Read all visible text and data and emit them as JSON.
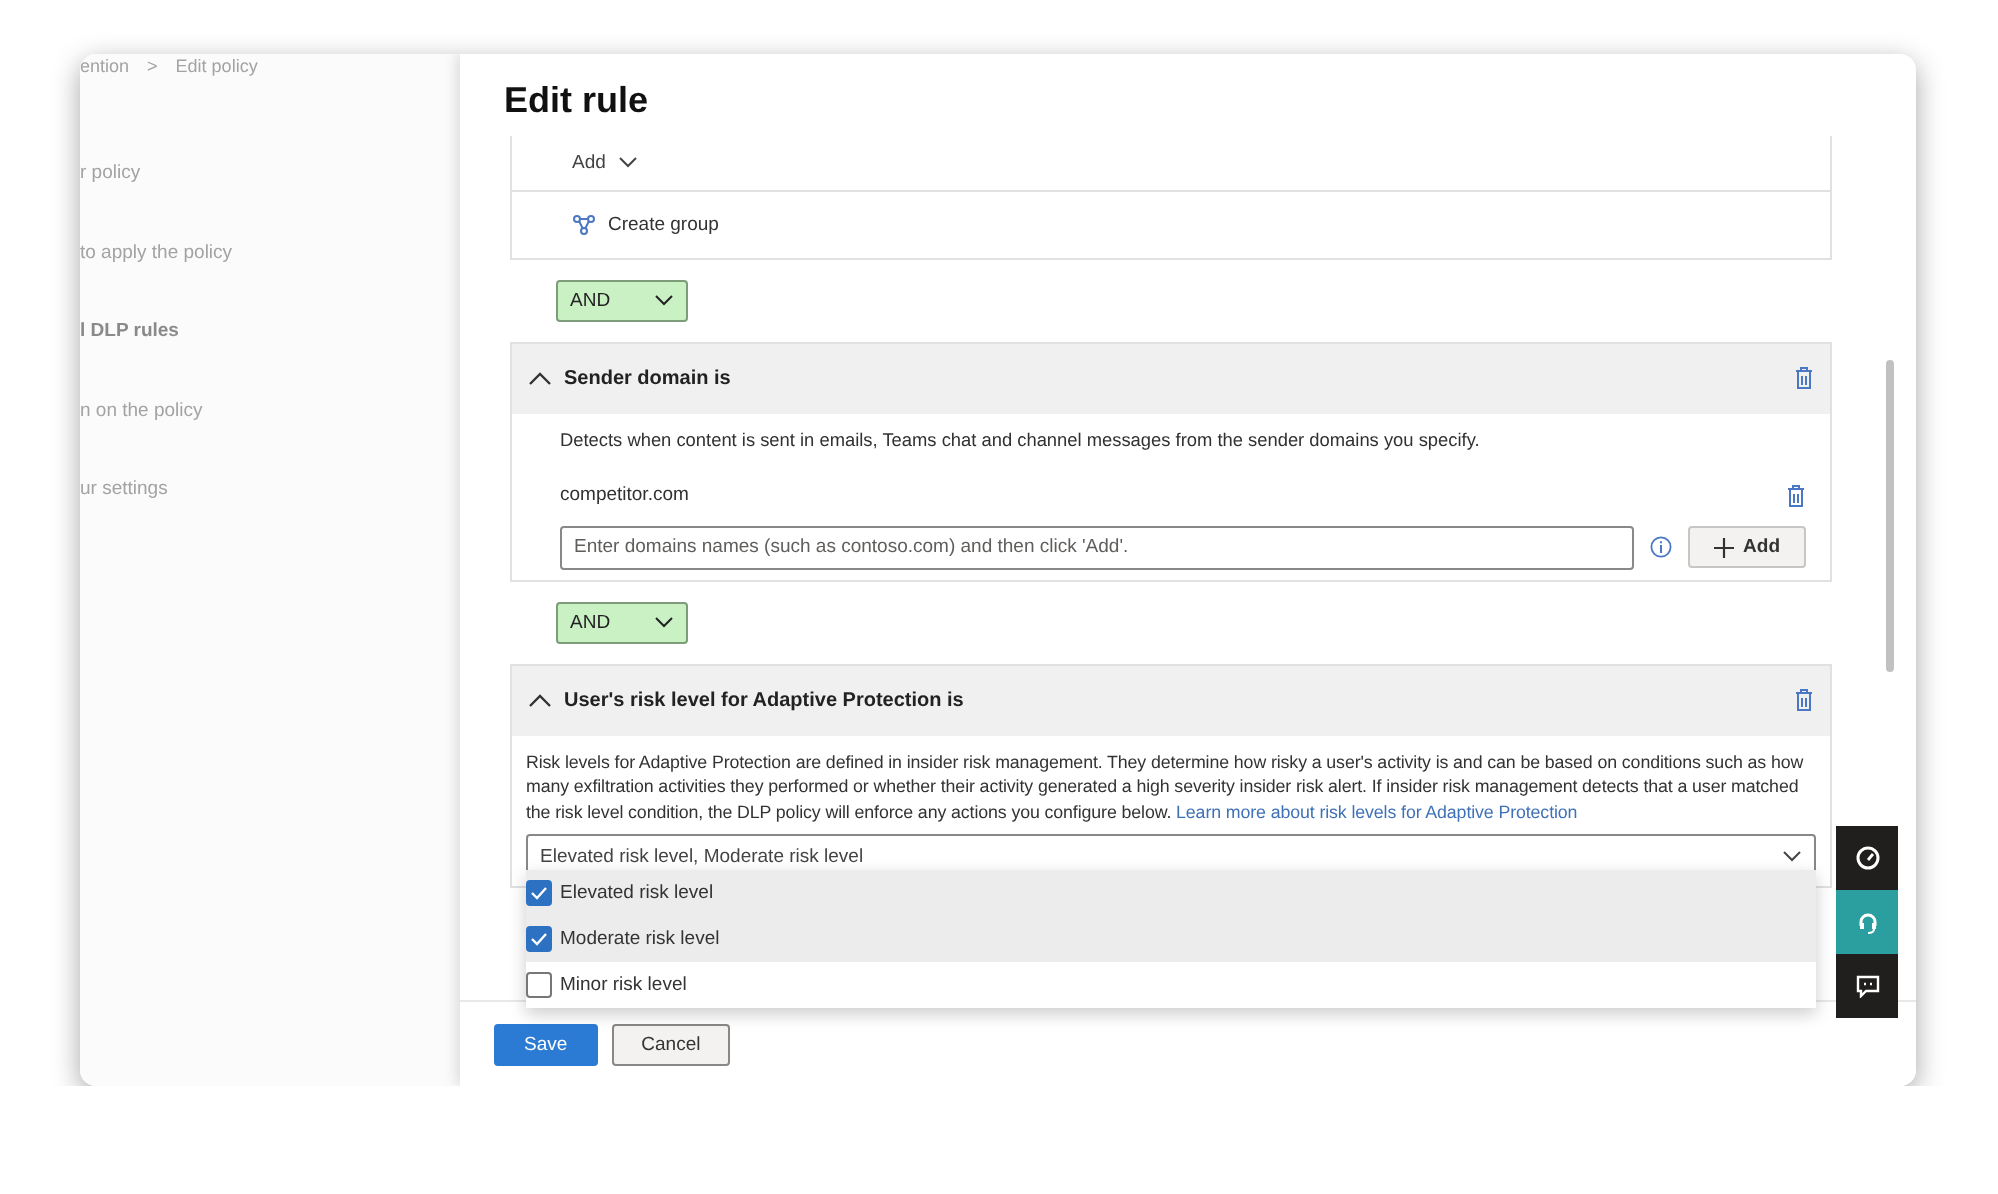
{
  "sidebar": {
    "breadcrumb": {
      "items": [
        "ention",
        "Edit policy"
      ],
      "separator": ">"
    },
    "items": [
      {
        "label": "r policy",
        "selected": false
      },
      {
        "label": "to apply the policy",
        "selected": false
      },
      {
        "label": "l DLP rules",
        "selected": true
      },
      {
        "label": "n on the policy",
        "selected": false
      },
      {
        "label": "ur settings",
        "selected": false
      }
    ]
  },
  "panel": {
    "title": "Edit rule",
    "top_card": {
      "add_label": "Add",
      "create_group": "Create group"
    },
    "conditions": [
      {
        "kind": "domains",
        "operator": "AND",
        "title": "Sender domain is",
        "expanded": true,
        "description": "Detects when content is sent in emails, Teams chat and channel messages from the sender domains you specify.",
        "domains": [
          "competitor.com"
        ],
        "input": {
          "placeholder": "Enter domains names (such as contoso.com) and then click 'Add'."
        },
        "add_button": "Add"
      },
      {
        "kind": "risk",
        "operator": "AND",
        "title": "User's risk level for Adaptive Protection is",
        "expanded": true,
        "description": "Risk levels for Adaptive Protection are defined in insider risk management. They determine how risky a user's activity is and can be based on conditions such as how many exfiltration activities they performed or whether their activity generated a high severity insider risk alert. If insider risk management detects that a user matched the risk level condition, the DLP policy will enforce any actions you configure below.",
        "link": "Learn more about risk levels for Adaptive Protection",
        "dropdown": {
          "value": "Elevated risk level, Moderate risk level",
          "expanded": true,
          "options": [
            {
              "label": "Elevated risk level",
              "checked": true
            },
            {
              "label": "Moderate risk level",
              "checked": true
            },
            {
              "label": "Minor risk level",
              "checked": false
            }
          ]
        }
      }
    ]
  },
  "footer": {
    "buttons": [
      {
        "kind": "primary",
        "label": "Save"
      },
      {
        "kind": "secondary",
        "label": "Cancel"
      }
    ]
  },
  "side_tools": [
    {
      "selected": false
    },
    {
      "selected": true
    },
    {
      "selected": false
    }
  ]
}
